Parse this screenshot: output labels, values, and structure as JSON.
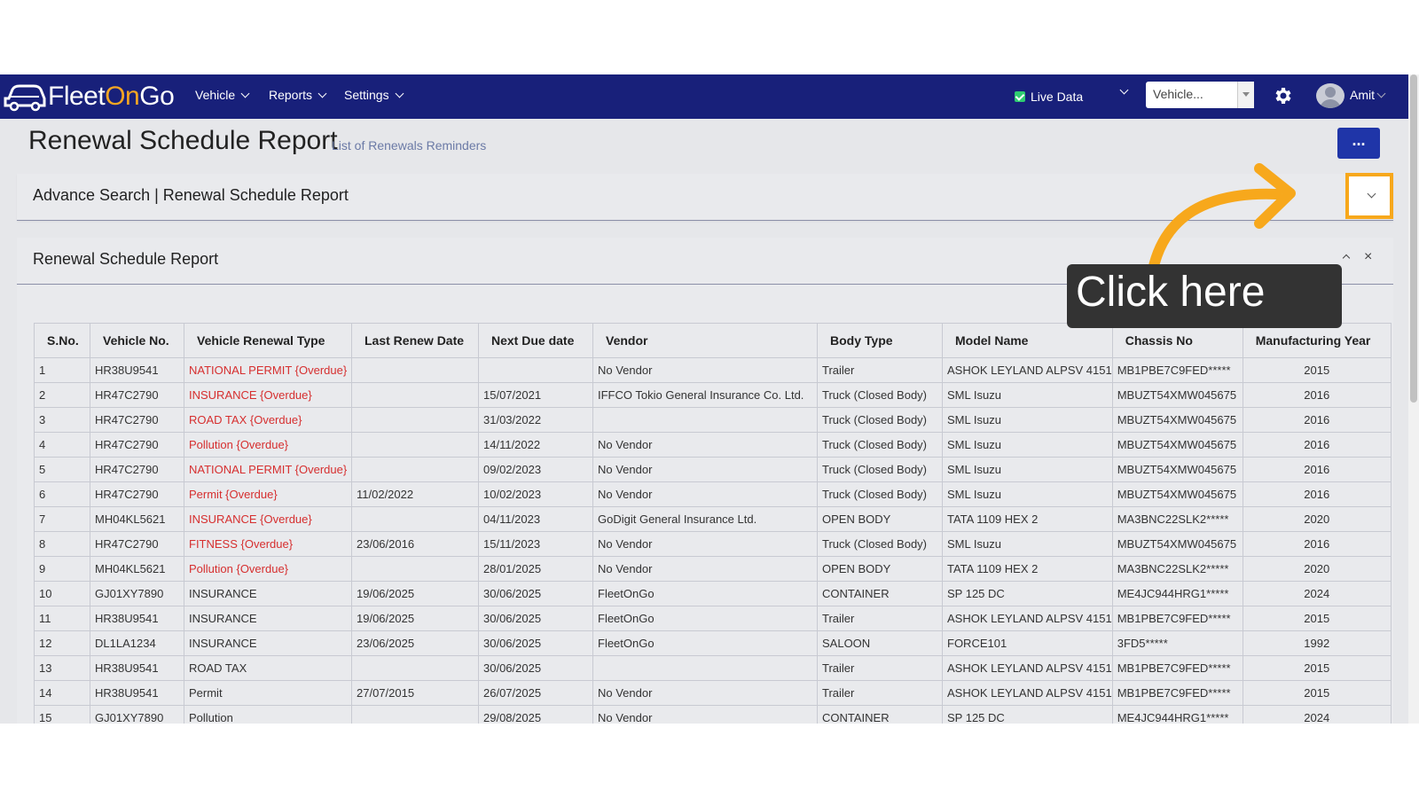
{
  "navbar": {
    "logo_prefix": "Fleet",
    "logo_on": "On",
    "logo_suffix": "Go",
    "menu": [
      "Vehicle",
      "Reports",
      "Settings"
    ],
    "live_data_label": "Live Data",
    "vehicle_select_value": "Vehicle...",
    "user_name": "Amit"
  },
  "page": {
    "title": "Renewal Schedule Report",
    "subtitle": "List of Renewals Reminders",
    "actions_label": "..."
  },
  "advance_search": {
    "title": "Advance Search | Renewal Schedule Report"
  },
  "report": {
    "title": "Renewal Schedule Report",
    "columns": [
      "S.No.",
      "Vehicle No.",
      "Vehicle Renewal Type",
      "Last Renew Date",
      "Next Due date",
      "Vendor",
      "Body Type",
      "Model Name",
      "Chassis No",
      "Manufacturing Year"
    ],
    "rows": [
      {
        "sno": "1",
        "vehicle": "HR38U9541",
        "type": "NATIONAL PERMIT {Overdue}",
        "overdue": true,
        "last": "",
        "next": "",
        "vendor": "No Vendor",
        "body": "Trailer",
        "model": "ASHOK LEYLAND ALPSV 4151",
        "chassis": "MB1PBE7C9FED*****",
        "year": "2015"
      },
      {
        "sno": "2",
        "vehicle": "HR47C2790",
        "type": "INSURANCE {Overdue}",
        "overdue": true,
        "last": "",
        "next": "15/07/2021",
        "vendor": "IFFCO Tokio General Insurance Co. Ltd.",
        "body": "Truck (Closed Body)",
        "model": "SML Isuzu",
        "chassis": "MBUZT54XMW045675",
        "year": "2016"
      },
      {
        "sno": "3",
        "vehicle": "HR47C2790",
        "type": "ROAD TAX {Overdue}",
        "overdue": true,
        "last": "",
        "next": "31/03/2022",
        "vendor": "",
        "body": "Truck (Closed Body)",
        "model": "SML Isuzu",
        "chassis": "MBUZT54XMW045675",
        "year": "2016"
      },
      {
        "sno": "4",
        "vehicle": "HR47C2790",
        "type": "Pollution {Overdue}",
        "overdue": true,
        "last": "",
        "next": "14/11/2022",
        "vendor": "No Vendor",
        "body": "Truck (Closed Body)",
        "model": "SML Isuzu",
        "chassis": "MBUZT54XMW045675",
        "year": "2016"
      },
      {
        "sno": "5",
        "vehicle": "HR47C2790",
        "type": "NATIONAL PERMIT {Overdue}",
        "overdue": true,
        "last": "",
        "next": "09/02/2023",
        "vendor": "No Vendor",
        "body": "Truck (Closed Body)",
        "model": "SML Isuzu",
        "chassis": "MBUZT54XMW045675",
        "year": "2016"
      },
      {
        "sno": "6",
        "vehicle": "HR47C2790",
        "type": "Permit {Overdue}",
        "overdue": true,
        "last": "11/02/2022",
        "next": "10/02/2023",
        "vendor": "No Vendor",
        "body": "Truck (Closed Body)",
        "model": "SML Isuzu",
        "chassis": "MBUZT54XMW045675",
        "year": "2016"
      },
      {
        "sno": "7",
        "vehicle": "MH04KL5621",
        "type": "INSURANCE {Overdue}",
        "overdue": true,
        "last": "",
        "next": "04/11/2023",
        "vendor": "GoDigit General Insurance Ltd.",
        "body": "OPEN BODY",
        "model": "TATA 1109 HEX 2",
        "chassis": "MA3BNC22SLK2*****",
        "year": "2020"
      },
      {
        "sno": "8",
        "vehicle": "HR47C2790",
        "type": "FITNESS {Overdue}",
        "overdue": true,
        "last": "23/06/2016",
        "next": "15/11/2023",
        "vendor": "No Vendor",
        "body": "Truck (Closed Body)",
        "model": "SML Isuzu",
        "chassis": "MBUZT54XMW045675",
        "year": "2016"
      },
      {
        "sno": "9",
        "vehicle": "MH04KL5621",
        "type": "Pollution {Overdue}",
        "overdue": true,
        "last": "",
        "next": "28/01/2025",
        "vendor": "No Vendor",
        "body": "OPEN BODY",
        "model": "TATA 1109 HEX 2",
        "chassis": "MA3BNC22SLK2*****",
        "year": "2020"
      },
      {
        "sno": "10",
        "vehicle": "GJ01XY7890",
        "type": "INSURANCE",
        "overdue": false,
        "last": "19/06/2025",
        "next": "30/06/2025",
        "vendor": "FleetOnGo",
        "body": "CONTAINER",
        "model": "SP 125 DC",
        "chassis": "ME4JC944HRG1*****",
        "year": "2024"
      },
      {
        "sno": "11",
        "vehicle": "HR38U9541",
        "type": "INSURANCE",
        "overdue": false,
        "last": "19/06/2025",
        "next": "30/06/2025",
        "vendor": "FleetOnGo",
        "body": "Trailer",
        "model": "ASHOK LEYLAND ALPSV 4151",
        "chassis": "MB1PBE7C9FED*****",
        "year": "2015"
      },
      {
        "sno": "12",
        "vehicle": "DL1LA1234",
        "type": "INSURANCE",
        "overdue": false,
        "last": "23/06/2025",
        "next": "30/06/2025",
        "vendor": "FleetOnGo",
        "body": "SALOON",
        "model": "FORCE101",
        "chassis": "3FD5*****",
        "year": "1992"
      },
      {
        "sno": "13",
        "vehicle": "HR38U9541",
        "type": "ROAD TAX",
        "overdue": false,
        "last": "",
        "next": "30/06/2025",
        "vendor": "",
        "body": "Trailer",
        "model": "ASHOK LEYLAND ALPSV 4151",
        "chassis": "MB1PBE7C9FED*****",
        "year": "2015"
      },
      {
        "sno": "14",
        "vehicle": "HR38U9541",
        "type": "Permit",
        "overdue": false,
        "last": "27/07/2015",
        "next": "26/07/2025",
        "vendor": "No Vendor",
        "body": "Trailer",
        "model": "ASHOK LEYLAND ALPSV 4151",
        "chassis": "MB1PBE7C9FED*****",
        "year": "2015"
      },
      {
        "sno": "15",
        "vehicle": "GJ01XY7890",
        "type": "Pollution",
        "overdue": false,
        "last": "",
        "next": "29/08/2025",
        "vendor": "No Vendor",
        "body": "CONTAINER",
        "model": "SP 125 DC",
        "chassis": "ME4JC944HRG1*****",
        "year": "2024"
      }
    ]
  },
  "annotation": {
    "callout_text": "Click here"
  },
  "colors": {
    "navbar": "#18207a",
    "accent": "#f7a81c",
    "overdue": "#d62f2f",
    "primary_button": "#1f35a8"
  },
  "icons": [
    "truck-logo-icon",
    "check-icon",
    "chevron-down-icon",
    "gear-icon",
    "avatar-icon",
    "chevron-up-icon",
    "close-icon",
    "more-icon",
    "arrow-icon"
  ]
}
